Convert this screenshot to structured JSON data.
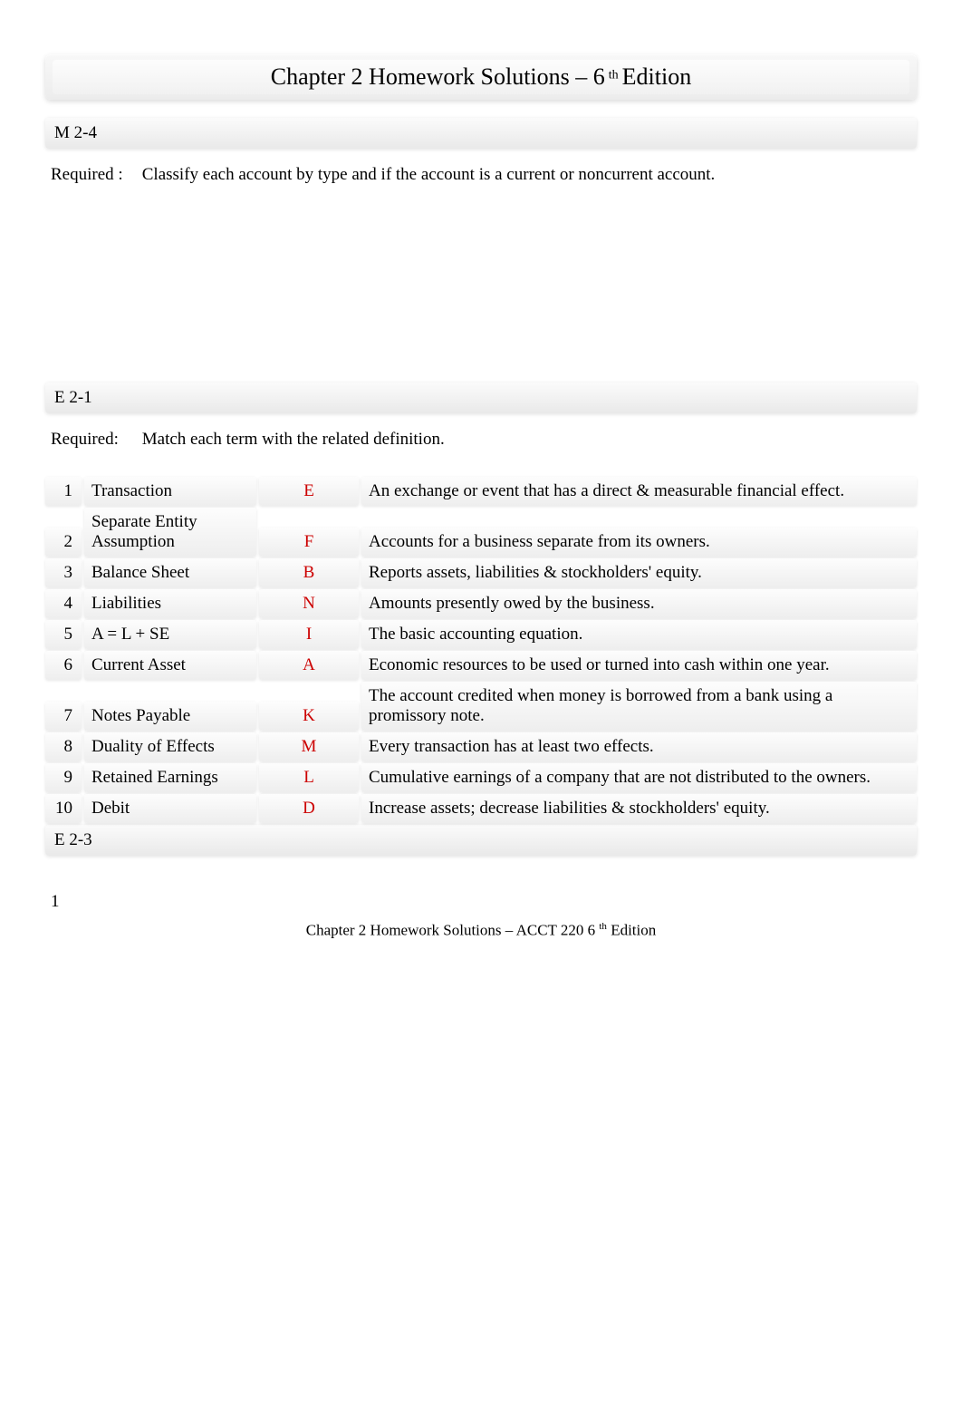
{
  "title": {
    "prefix": "Chapter 2 Homework Solutions – 6",
    "sup": "th",
    "suffix": "  Edition"
  },
  "sections": {
    "m24": {
      "heading": "M 2-4",
      "required_label": "Required :",
      "required_text": "Classify each account by type and if the account is a current or noncurrent account."
    },
    "e21": {
      "heading": "E 2-1",
      "required_label": "Required:",
      "required_text": "Match each term with the related definition.",
      "rows": [
        {
          "num": "1",
          "term": "Transaction",
          "letter": "E",
          "def": "An exchange or event that has a direct & measurable financial effect."
        },
        {
          "num": "2",
          "term": "Separate Entity Assumption",
          "letter": "F",
          "def": "Accounts for a business separate from its owners."
        },
        {
          "num": "3",
          "term": "Balance Sheet",
          "letter": "B",
          "def": "Reports assets, liabilities & stockholders' equity."
        },
        {
          "num": "4",
          "term": "Liabilities",
          "letter": "N",
          "def": "Amounts presently owed by the business."
        },
        {
          "num": "5",
          "term": "A = L + SE",
          "letter": "I",
          "def": "The basic accounting equation."
        },
        {
          "num": "6",
          "term": "Current Asset",
          "letter": "A",
          "def": "Economic resources to be used or turned into cash within one year."
        },
        {
          "num": "7",
          "term": "Notes Payable",
          "letter": "K",
          "def": "The account credited when money is borrowed from a bank using a promissory note."
        },
        {
          "num": "8",
          "term": "Duality of Effects",
          "letter": "M",
          "def": "Every transaction has at least two effects."
        },
        {
          "num": "9",
          "term": "Retained Earnings",
          "letter": "L",
          "def": "Cumulative earnings of a company that are not distributed to the owners."
        },
        {
          "num": "10",
          "term": "Debit",
          "letter": "D",
          "def": "Increase assets; decrease liabilities & stockholders' equity."
        }
      ]
    },
    "e23": {
      "heading": "E 2-3"
    }
  },
  "page_number": "1",
  "footer": {
    "prefix": "Chapter 2 Homework Solutions – ACCT 220 6",
    "sup": "th",
    "suffix": "  Edition"
  }
}
